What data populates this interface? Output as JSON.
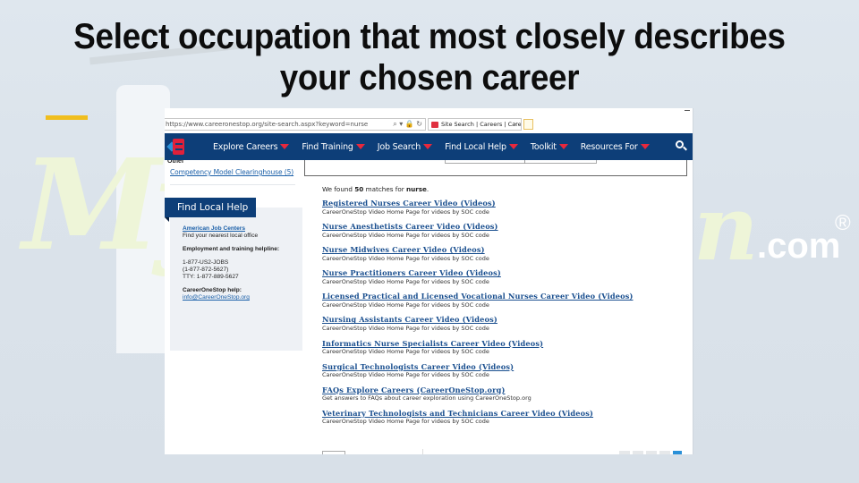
{
  "slide": {
    "title": "Select occupation that most closely describes your chosen career",
    "accent_color": "#f0be1e",
    "watermark": {
      "script_text": "My",
      "script_tail": "n",
      "suffix": ".com",
      "registered": "®"
    }
  },
  "browser": {
    "url": "https://www.careeronestop.org/site-search.aspx?keyword=nurse",
    "url_icons": "⌕ ▾ 🔒 ↻",
    "tab_title": "Site Search | Careers | Care...",
    "tab_close": "×"
  },
  "site": {
    "brand_color": "#0d3e78",
    "accent_color": "#e8283c",
    "nav": [
      {
        "label": "Explore Careers",
        "has_dropdown": true
      },
      {
        "label": "Find Training",
        "has_dropdown": true
      },
      {
        "label": "Job Search",
        "has_dropdown": true
      },
      {
        "label": "Find Local Help",
        "has_dropdown": true
      },
      {
        "label": "Toolkit",
        "has_dropdown": true
      },
      {
        "label": "Resources For",
        "has_dropdown": true
      }
    ],
    "search_icon": "search-icon"
  },
  "sidebar": {
    "other_label": "Other",
    "facet_link": "Competency Model Clearinghouse (5)",
    "find_local_help": {
      "title": "Find Local Help",
      "ajc_link": "American Job Centers",
      "ajc_desc": "Find your nearest local office",
      "helpline_label": "Employment and training helpline:",
      "phone1": "1-877-US2-JOBS",
      "phone2": "(1-877-872-5627)",
      "tty": "TTY: 1-877-889-5627",
      "help_label": "CareerOneStop help:",
      "email": "info@CareerOneStop.org"
    }
  },
  "results": {
    "summary_prefix": "We found",
    "count": "50",
    "summary_mid": "matches for",
    "keyword": "nurse",
    "items": [
      {
        "title": "Registered Nurses Career Video (Videos)",
        "desc": "CareerOneStop Video Home Page for videos by SOC code"
      },
      {
        "title": "Nurse Anesthetists Career Video (Videos)",
        "desc": "CareerOneStop Video Home Page for videos by SOC code"
      },
      {
        "title": "Nurse Midwives Career Video (Videos)",
        "desc": "CareerOneStop Video Home Page for videos by SOC code"
      },
      {
        "title": "Nurse Practitioners Career Video (Videos)",
        "desc": "CareerOneStop Video Home Page for videos by SOC code"
      },
      {
        "title": "Licensed Practical and Licensed Vocational Nurses Career Video (Videos)",
        "desc": "CareerOneStop Video Home Page for videos by SOC code"
      },
      {
        "title": "Nursing Assistants Career Video (Videos)",
        "desc": "CareerOneStop Video Home Page for videos by SOC code"
      },
      {
        "title": "Informatics Nurse Specialists Career Video (Videos)",
        "desc": "CareerOneStop Video Home Page for videos by SOC code"
      },
      {
        "title": "Surgical Technologists Career Video (Videos)",
        "desc": "CareerOneStop Video Home Page for videos by SOC code"
      },
      {
        "title": "FAQs Explore Careers (CareerOneStop.org)",
        "desc": "Get answers to FAQs about career exploration using CareerOneStop.org"
      },
      {
        "title": "Veterinary Technologists and Technicians Career Video (Videos)",
        "desc": "CareerOneStop Video Home Page for videos by SOC code"
      }
    ]
  }
}
